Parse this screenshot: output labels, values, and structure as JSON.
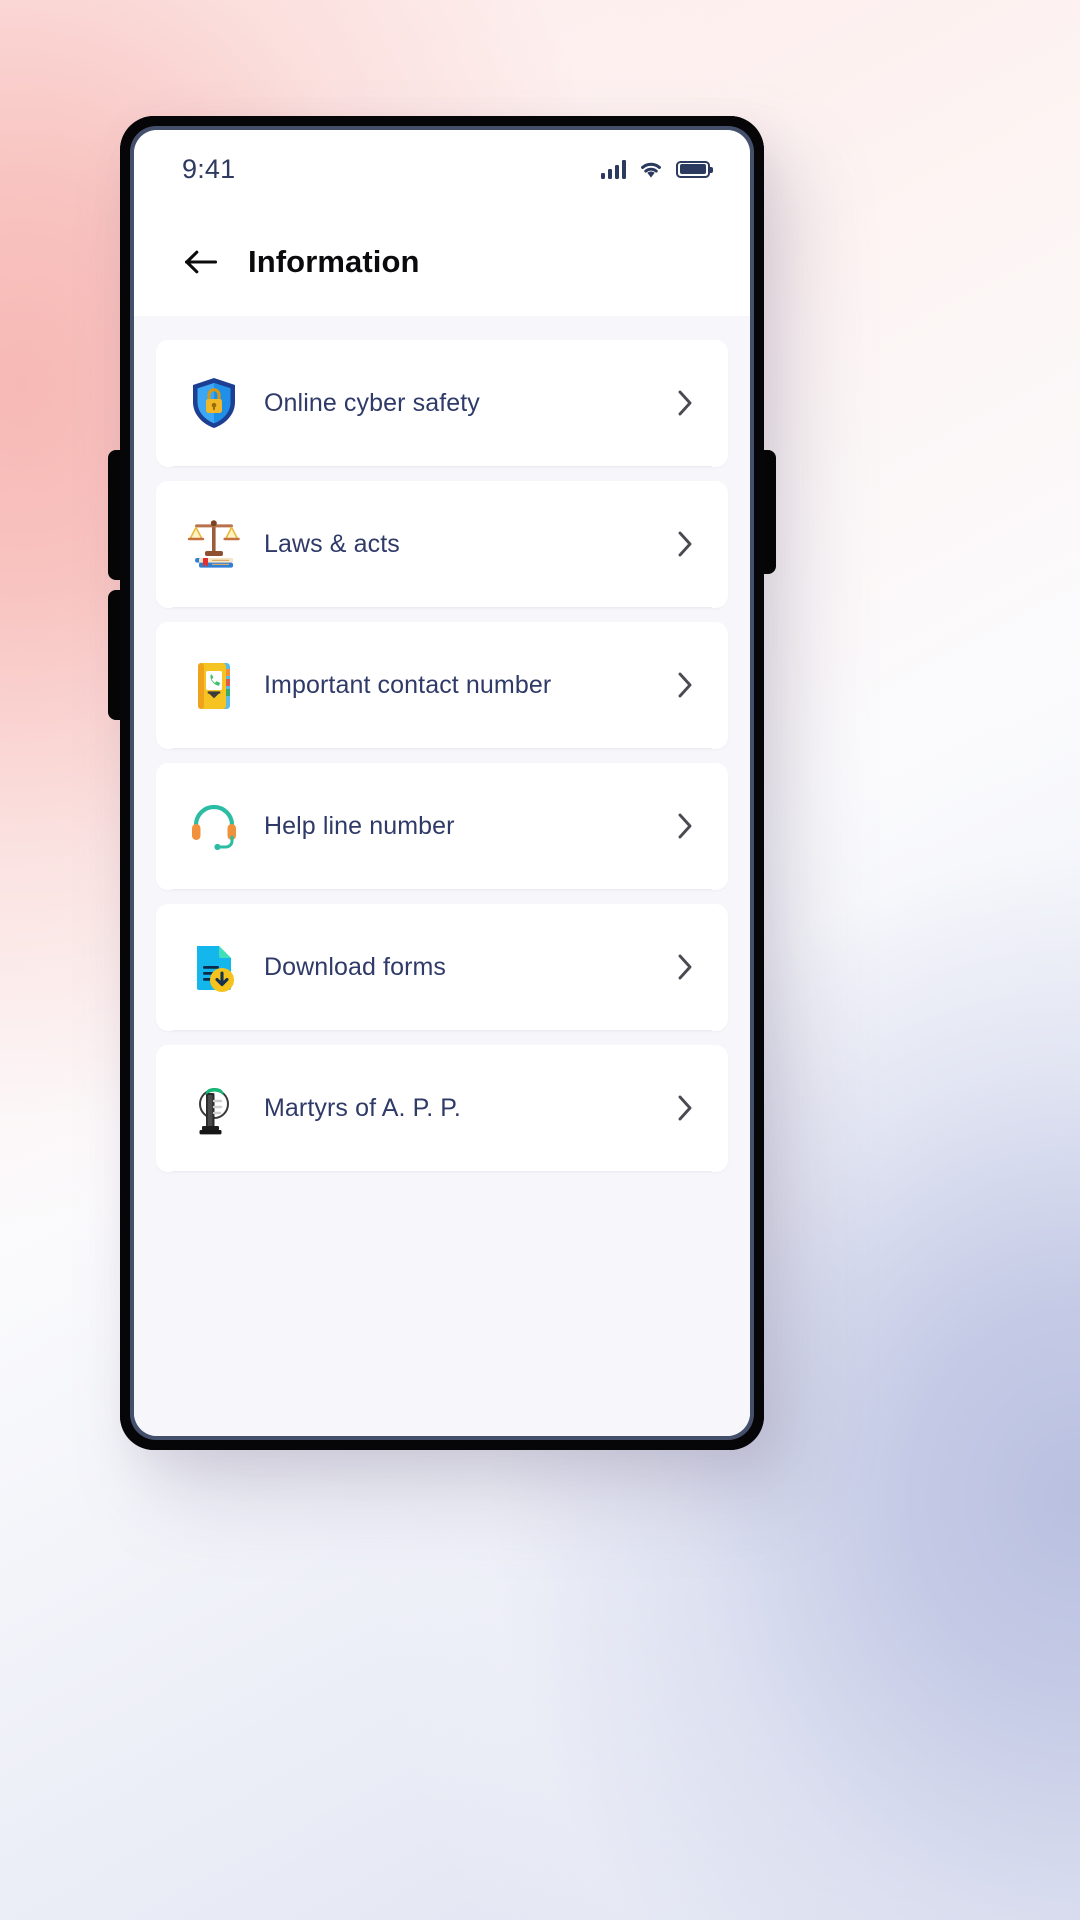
{
  "status_bar": {
    "time": "9:41",
    "signal_icon": "signal-bars-icon",
    "wifi_icon": "wifi-icon",
    "battery_icon": "battery-full-icon"
  },
  "header": {
    "back_icon": "arrow-left-icon",
    "title": "Information"
  },
  "list": {
    "chevron_icon": "chevron-right-icon",
    "items": [
      {
        "label": "Online cyber safety",
        "icon": "shield-lock-icon"
      },
      {
        "label": "Laws & acts",
        "icon": "scales-of-justice-icon"
      },
      {
        "label": "Important contact number",
        "icon": "phone-book-icon"
      },
      {
        "label": "Help line number",
        "icon": "headset-icon"
      },
      {
        "label": "Download forms",
        "icon": "document-download-icon"
      },
      {
        "label": "Martyrs of A. P. P.",
        "icon": "memorial-monument-icon"
      }
    ]
  },
  "colors": {
    "screen_bg": "#f6f6fb",
    "card_bg": "#ffffff",
    "label_text": "#2f3a68",
    "title_text": "#0b0b0d",
    "status_icon": "#2b3a5e",
    "chevron": "#4a4a52",
    "frame": "#060608",
    "bezel": "#44506b"
  }
}
